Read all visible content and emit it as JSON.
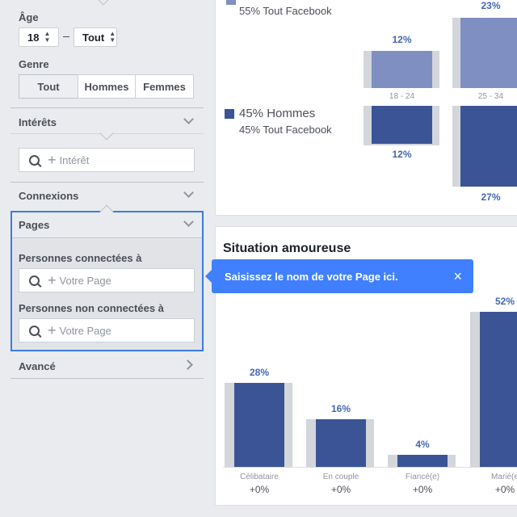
{
  "sidebar": {
    "age_label": "Âge",
    "age_min": "18",
    "age_max": "Tout",
    "gender_label": "Genre",
    "gender_options": [
      "Tout",
      "Hommes",
      "Femmes"
    ],
    "interests_title": "Intérêts",
    "interest_placeholder": "Intérêt",
    "connections_title": "Connexions",
    "pages_title": "Pages",
    "connected_label": "Personnes connectées à",
    "connected_placeholder": "Votre Page",
    "not_connected_label": "Personnes non connectées à",
    "not_connected_placeholder": "Votre Page",
    "advanced_title": "Avancé"
  },
  "gender_card": {
    "women_sub": "55% Tout Facebook",
    "men_main": "45% Hommes",
    "men_sub": "45% Tout Facebook",
    "age_groups": [
      "18 - 24",
      "25 - 34"
    ],
    "women_values": [
      "12%",
      "23%"
    ],
    "men_values": [
      "12%",
      "27%"
    ],
    "colors": {
      "women": "#7f8fc1",
      "men": "#3b5495",
      "ghost": "#d3d6db"
    }
  },
  "relationship_card": {
    "title": "Situation amoureuse",
    "categories": [
      "Célibataire",
      "En couple",
      "Fiancé(e)",
      "Marié(e"
    ],
    "values": [
      "28%",
      "16%",
      "4%",
      "52%"
    ],
    "deltas": [
      "+0%",
      "+0%",
      "+0%",
      "+0%"
    ]
  },
  "tooltip": {
    "text": "Saisissez le nom de votre Page ici.",
    "close": "×"
  },
  "chart_data": {
    "type": "bar",
    "title": "Situation amoureuse",
    "categories": [
      "Célibataire",
      "En couple",
      "Fiancé(e)",
      "Marié(e"
    ],
    "values": [
      28,
      16,
      4,
      52
    ],
    "ylim": [
      0,
      55
    ]
  }
}
